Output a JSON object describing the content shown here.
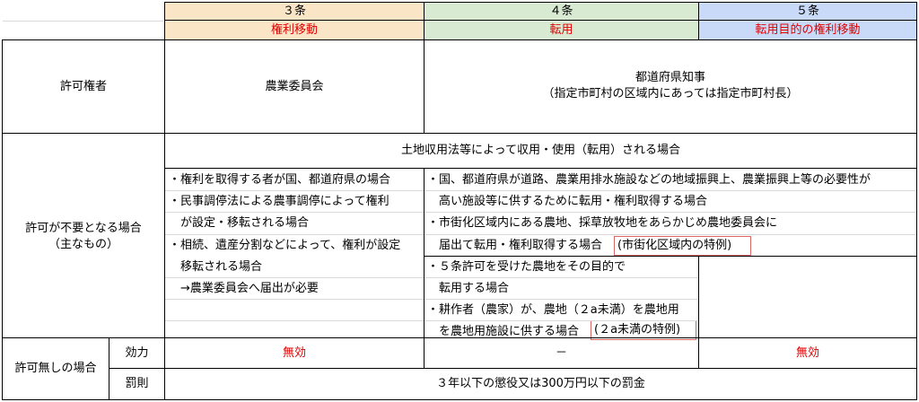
{
  "header": {
    "col1": {
      "num": "３条",
      "sub": "権利移動"
    },
    "col2": {
      "num": "４条",
      "sub": "転用"
    },
    "col3": {
      "num": "５条",
      "sub": "転用目的の権利移動"
    }
  },
  "rows": {
    "permitter": {
      "label": "許可権者",
      "col1": "農業委員会",
      "col23_line1": "都道府県知事",
      "col23_line2": "（指定市町村の区域内にあっては指定市町村長）"
    },
    "no_permit": {
      "label_line1": "許可が不要となる場合",
      "label_line2": "（主なもの）",
      "span_all": "土地収用法等によって収用・使用（転用）される場合",
      "col1_lines": [
        "・権利を取得する者が国、都道府県の場合",
        "・民事調停法による農事調停によって権利",
        "　が設定・移転される場合",
        "・相続、遺産分割などによって、権利が設定",
        "　移転される場合",
        "　→農業委員会へ届出が必要"
      ],
      "col23_lines": [
        "・国、都道府県が道路、農業用排水施設などの地域振興上、農業振興上等の必要性が",
        "　高い施設等に供するために転用・権利取得する場合",
        "・市街化区域内にある農地、採草放牧地をあらかじめ農地委員会に",
        "　届出て転用・権利取得する場合"
      ],
      "col23_tag": "(市街化区域内の特例)",
      "col2_lines": [
        "・５条許可を受けた農地をその目的で",
        "　転用する場合",
        "・耕作者（農家）が、農地（２a未満）を農地用",
        "　を農地用施設に供する場合"
      ],
      "col2_tag": "(２a未満の特例)"
    },
    "no_permission": {
      "label": "許可無しの場合",
      "effect_label": "効力",
      "effect_col1": "無効",
      "effect_col2": "－",
      "effect_col3": "無効",
      "penalty_label": "罰則",
      "penalty": "３年以下の懲役又は300万円以下の罰金"
    }
  }
}
